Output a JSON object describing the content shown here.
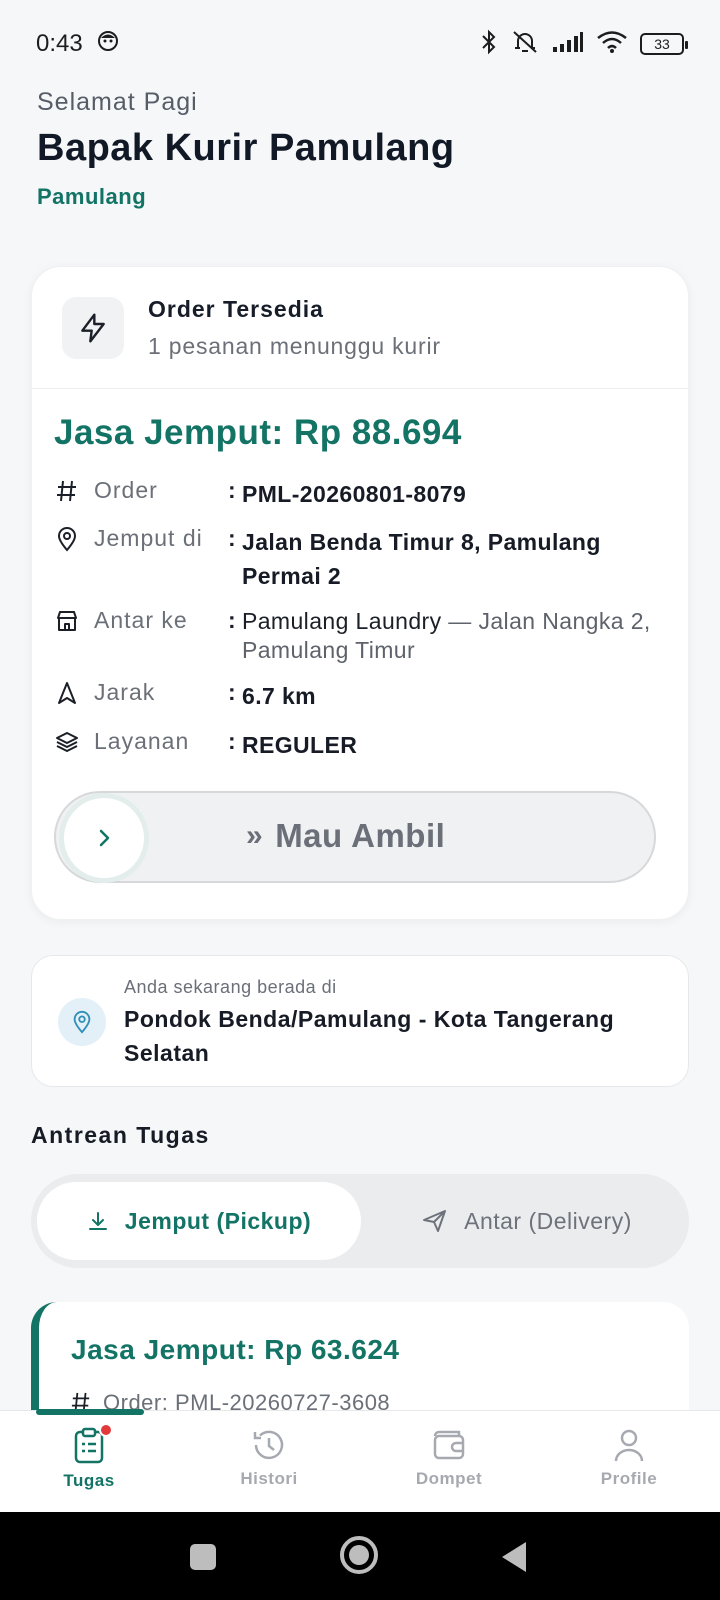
{
  "status_bar": {
    "time": "0:43",
    "battery": "33"
  },
  "greeting": {
    "salutation": "Selamat Pagi",
    "name": "Bapak Kurir Pamulang",
    "location": "Pamulang"
  },
  "available_order": {
    "title": "Order Tersedia",
    "subtitle": "1 pesanan menunggu kurir",
    "price": "Jasa Jemput: Rp 88.694",
    "rows": [
      {
        "icon": "hash-icon",
        "label": "Order",
        "value": "PML-20260801-8079"
      },
      {
        "icon": "map-pin-icon",
        "label": "Jemput di",
        "value": "Jalan Benda Timur 8, Pamulang Permai 2"
      },
      {
        "icon": "store-icon",
        "label": "Antar ke",
        "value": "Pamulang Laundry",
        "value_extra": " — Jalan Nangka 2, Pamulang Timur"
      },
      {
        "icon": "navigation-icon",
        "label": "Jarak",
        "value": "6.7 km"
      },
      {
        "icon": "layers-icon",
        "label": "Layanan",
        "value": "REGULER"
      }
    ],
    "colon": ":",
    "slider_label": "Mau Ambil",
    "slider_arrows": "»"
  },
  "current_location": {
    "caption": "Anda sekarang berada di",
    "place": "Pondok Benda/Pamulang - Kota Tangerang Selatan"
  },
  "queue": {
    "title": "Antrean Tugas",
    "tabs": [
      {
        "label": "Jemput (Pickup)",
        "active": true
      },
      {
        "label": "Antar (Delivery)",
        "active": false
      }
    ],
    "task": {
      "price": "Jasa Jemput: Rp 63.624",
      "order_text": "Order: PML-20260727-3608"
    }
  },
  "bottom_nav": [
    {
      "label": "Tugas",
      "icon": "clipboard-icon",
      "active": true,
      "badge": true
    },
    {
      "label": "Histori",
      "icon": "history-icon",
      "active": false
    },
    {
      "label": "Dompet",
      "icon": "wallet-icon",
      "active": false
    },
    {
      "label": "Profile",
      "icon": "user-icon",
      "active": false
    }
  ],
  "colors": {
    "primary": "#137466",
    "badge": "#e2393a",
    "background": "#f6f7f9"
  }
}
